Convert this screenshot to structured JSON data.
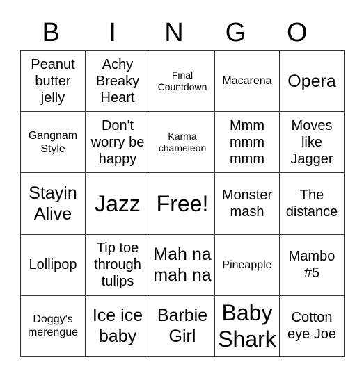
{
  "header": [
    "B",
    "I",
    "N",
    "G",
    "O"
  ],
  "rows": [
    [
      {
        "text": "Peanut butter jelly",
        "size": "md"
      },
      {
        "text": "Achy Breaky Heart",
        "size": "md"
      },
      {
        "text": "Final Countdown",
        "size": "xs"
      },
      {
        "text": "Macarena",
        "size": "sm"
      },
      {
        "text": "Opera",
        "size": "lg"
      }
    ],
    [
      {
        "text": "Gangnam Style",
        "size": "sm"
      },
      {
        "text": "Don't worry be happy",
        "size": "md"
      },
      {
        "text": "Karma chameleon",
        "size": "xs"
      },
      {
        "text": "Mmm mmm mmm",
        "size": "md"
      },
      {
        "text": "Moves like Jagger",
        "size": "md"
      }
    ],
    [
      {
        "text": "Stayin Alive",
        "size": "lg"
      },
      {
        "text": "Jazz",
        "size": "xl"
      },
      {
        "text": "Free!",
        "size": "xl"
      },
      {
        "text": "Monster mash",
        "size": "md"
      },
      {
        "text": "The distance",
        "size": "md"
      }
    ],
    [
      {
        "text": "Lollipop",
        "size": "md"
      },
      {
        "text": "Tip toe through tulips",
        "size": "md"
      },
      {
        "text": "Mah na mah na",
        "size": "lg"
      },
      {
        "text": "Pineapple",
        "size": "sm"
      },
      {
        "text": "Mambo #5",
        "size": "md"
      }
    ],
    [
      {
        "text": "Doggy's merengue",
        "size": "sm"
      },
      {
        "text": "Ice ice baby",
        "size": "lg"
      },
      {
        "text": "Barbie Girl",
        "size": "lg"
      },
      {
        "text": "Baby Shark",
        "size": "xl"
      },
      {
        "text": "Cotton eye Joe",
        "size": "md"
      }
    ]
  ]
}
